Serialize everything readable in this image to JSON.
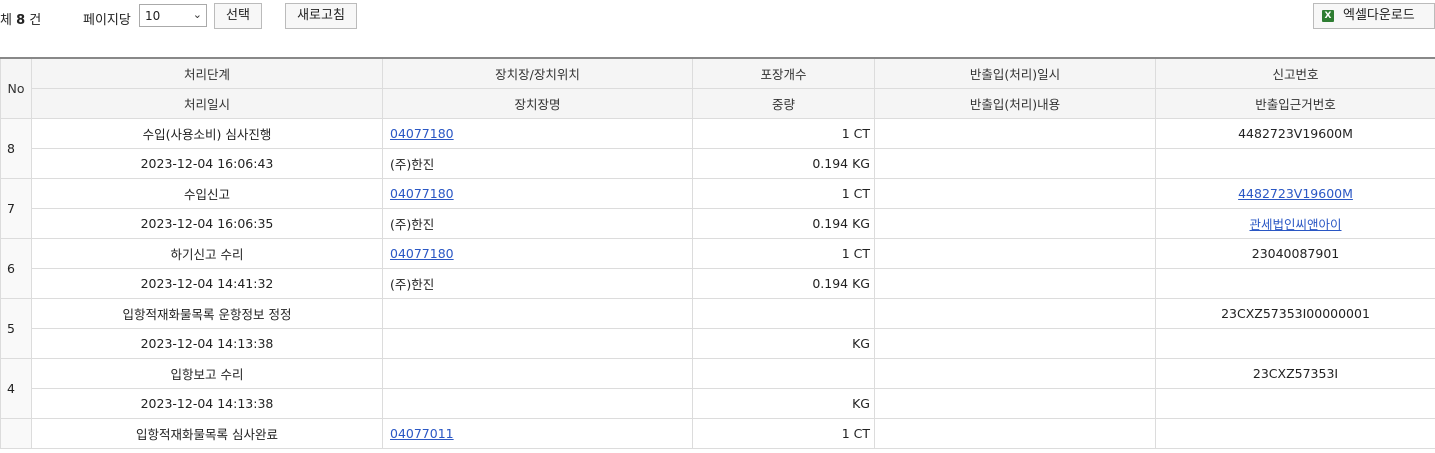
{
  "toolbar": {
    "total_prefix": "체",
    "total_count": "8",
    "total_suffix": "건",
    "per_page_label": "페이지당",
    "per_page_value": "10",
    "select_label": "선택",
    "refresh_label": "새로고침",
    "excel_icon": "excel-icon",
    "excel_label": "엑셀다운로드"
  },
  "table": {
    "headers": {
      "no": "No",
      "row1": [
        "처리단계",
        "장치장/장치위치",
        "포장개수",
        "반출입(처리)일시",
        "신고번호"
      ],
      "row2": [
        "처리일시",
        "장치장명",
        "중량",
        "반출입(처리)내용",
        "반출입근거번호"
      ]
    },
    "rows": [
      {
        "no": "8",
        "stage": "수입(사용소비) 심사진행",
        "location": "04077180",
        "packages": "1 CT",
        "inout_datetime": "",
        "report_no": "4482723V19600M",
        "datetime": "2023-12-04 16:06:43",
        "warehouse": "(주)한진",
        "weight": "0.194 KG",
        "inout_content": "",
        "basis_no": ""
      },
      {
        "no": "7",
        "stage": "수입신고",
        "location": "04077180",
        "packages": "1 CT",
        "inout_datetime": "",
        "report_no": "4482723V19600M",
        "datetime": "2023-12-04 16:06:35",
        "warehouse": "(주)한진",
        "weight": "0.194 KG",
        "inout_content": "",
        "basis_no": "관세법인씨앤아이"
      },
      {
        "no": "6",
        "stage": "하기신고 수리",
        "location": "04077180",
        "packages": "1 CT",
        "inout_datetime": "",
        "report_no": "23040087901",
        "datetime": "2023-12-04 14:41:32",
        "warehouse": "(주)한진",
        "weight": "0.194 KG",
        "inout_content": "",
        "basis_no": ""
      },
      {
        "no": "5",
        "stage": "입항적재화물목록 운항정보 정정",
        "location": "",
        "packages": "",
        "inout_datetime": "",
        "report_no": "23CXZ57353I00000001",
        "datetime": "2023-12-04 14:13:38",
        "warehouse": "",
        "weight": "KG",
        "inout_content": "",
        "basis_no": ""
      },
      {
        "no": "4",
        "stage": "입항보고 수리",
        "location": "",
        "packages": "",
        "inout_datetime": "",
        "report_no": "23CXZ57353I",
        "datetime": "2023-12-04 14:13:38",
        "warehouse": "",
        "weight": "KG",
        "inout_content": "",
        "basis_no": ""
      },
      {
        "no": "",
        "stage": "입항적재화물목록 심사완료",
        "location": "04077011",
        "packages": "1 CT",
        "inout_datetime": "",
        "report_no": "",
        "datetime": "",
        "warehouse": "",
        "weight": "",
        "inout_content": "",
        "basis_no": ""
      }
    ]
  }
}
